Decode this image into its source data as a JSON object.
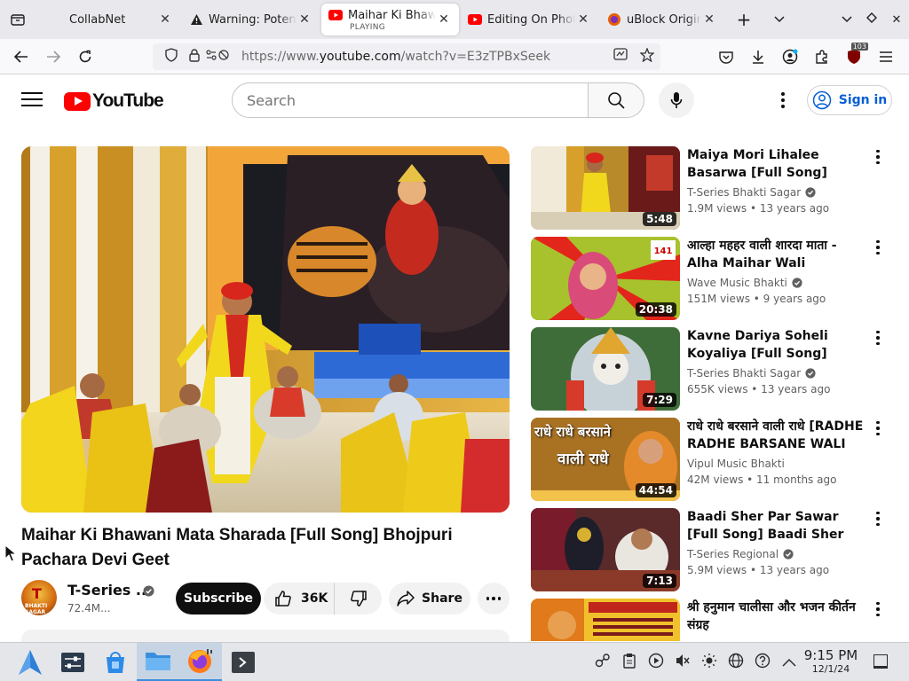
{
  "browser": {
    "tabs": [
      {
        "title": "CollabNet",
        "favicon": "blank-icon"
      },
      {
        "title": "Warning: Potential Security Risk Ahead",
        "favicon": "warning-icon"
      },
      {
        "title": "Maihar Ki Bhawani Mata",
        "subtitle": "PLAYING",
        "favicon": "youtube-icon",
        "active": true
      },
      {
        "title": "Editing On Photo",
        "favicon": "youtube-icon"
      },
      {
        "title": "uBlock Origin - ",
        "favicon": "firefox-icon"
      }
    ],
    "url_prefix": "https://www.",
    "url_host": "youtube.com",
    "url_path": "/watch?v=E3zTPBxSeek",
    "extension_badge": "103"
  },
  "youtube": {
    "logo_text": "YouTube",
    "search_placeholder": "Search",
    "sign_in_label": "Sign in",
    "accent": "#ff0000",
    "link_blue": "#065fd4"
  },
  "video": {
    "title": "Maihar Ki Bhawani Mata Sharada [Full Song] Bhojpuri Pachara Devi Geet",
    "channel": "T-Series ...",
    "subscribers": "72.4M...",
    "subscribe_label": "Subscribe",
    "likes": "36K",
    "share_label": "Share",
    "avatar_text": "T",
    "avatar_sub": "BHAKTI SAGAR"
  },
  "related": [
    {
      "title": "Maiya Mori Lihalee Basarwa [Full Song] Bhojpuri Pachara...",
      "channel": "T-Series Bhakti Sagar",
      "verified": true,
      "meta": "1.9M views • 13 years ago",
      "duration": "5:48"
    },
    {
      "title": "आल्हा महहर वाली शारदा माता - Alha Maihar Wali Shardha Mata ||...",
      "channel": "Wave Music Bhakti",
      "verified": true,
      "meta": "151M views • 9 years ago",
      "duration": "20:38"
    },
    {
      "title": "Kavne Dariya Soheli Koyaliya [Full Song] Bhojpuri Pachara...",
      "channel": "T-Series Bhakti Sagar",
      "verified": true,
      "meta": "655K views • 13 years ago",
      "duration": "7:29"
    },
    {
      "title": "राधे राधे बरसाने वाली राधे [RADHE RADHE BARSANE WALI RADH...",
      "channel": "Vipul Music Bhakti",
      "verified": false,
      "meta": "42M views • 11 months ago",
      "duration": "44:54",
      "thumb_text_1": "राधे राधे बरसाने",
      "thumb_text_2": "वाली राधे"
    },
    {
      "title": "Baadi Sher Par Sawar [Full Song] Baadi Sher Par Sawar",
      "channel": "T-Series Regional",
      "verified": true,
      "meta": "5.9M views • 13 years ago",
      "duration": "7:13"
    },
    {
      "title": "श्री हनुमान चालीसा और भजन कीर्तन संग्रह",
      "channel": "",
      "verified": false,
      "meta": "",
      "duration": ""
    }
  ],
  "taskbar": {
    "time": "9:15 PM",
    "date": "12/1/24"
  }
}
